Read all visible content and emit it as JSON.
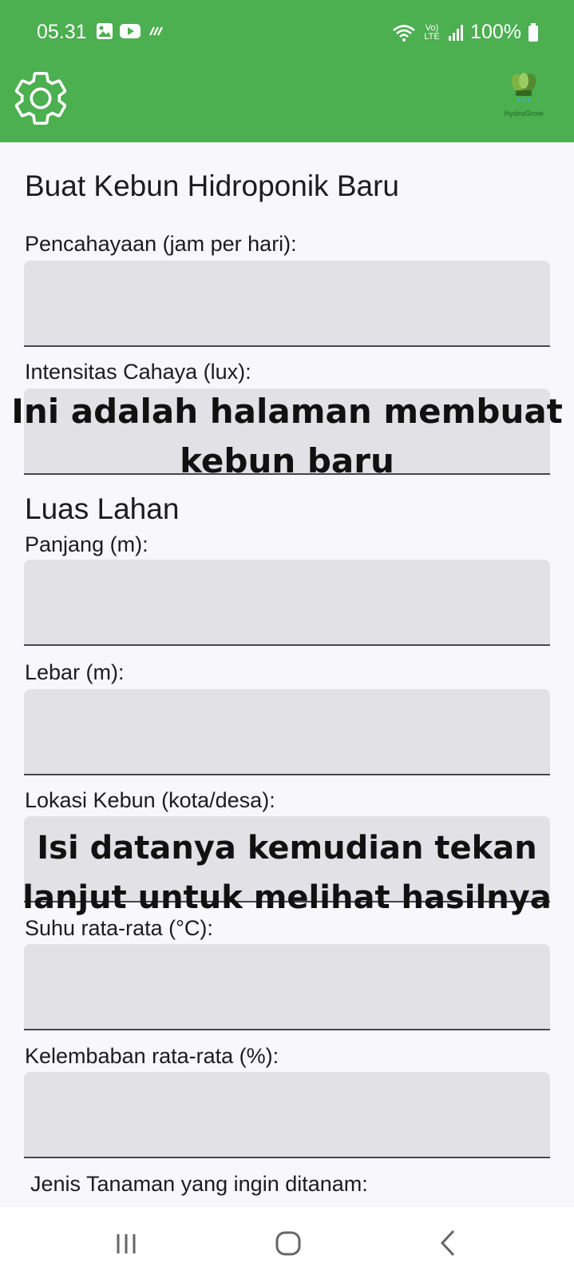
{
  "status_bar": {
    "time": "05.31",
    "network_label": "Vo) LTE",
    "battery": "100%"
  },
  "header": {
    "settings_icon": "gear-icon",
    "logo_text": "HydroGrow",
    "color": "#4caf50"
  },
  "form": {
    "title": "Buat Kebun Hidroponik Baru",
    "lighting_label": "Pencahayaan (jam per hari):",
    "intensity_label": "Intensitas Cahaya (lux):",
    "area_section": "Luas Lahan",
    "length_label": "Panjang (m):",
    "width_label": "Lebar (m):",
    "location_label": "Lokasi Kebun (kota/desa):",
    "temperature_label": "Suhu rata-rata (°C):",
    "humidity_label": "Kelembaban rata-rata (%):",
    "plant_type_label": "Jenis Tanaman yang ingin ditanam:"
  },
  "annotations": {
    "top_line1": "Ini adalah halaman membuat",
    "top_line2": "kebun baru",
    "bottom_line1": "Isi datanya kemudian tekan",
    "bottom_line2": "lanjut untuk melihat hasilnya"
  },
  "nav": {
    "recent_icon": "recent-apps-icon",
    "home_icon": "home-icon",
    "back_icon": "back-icon"
  }
}
